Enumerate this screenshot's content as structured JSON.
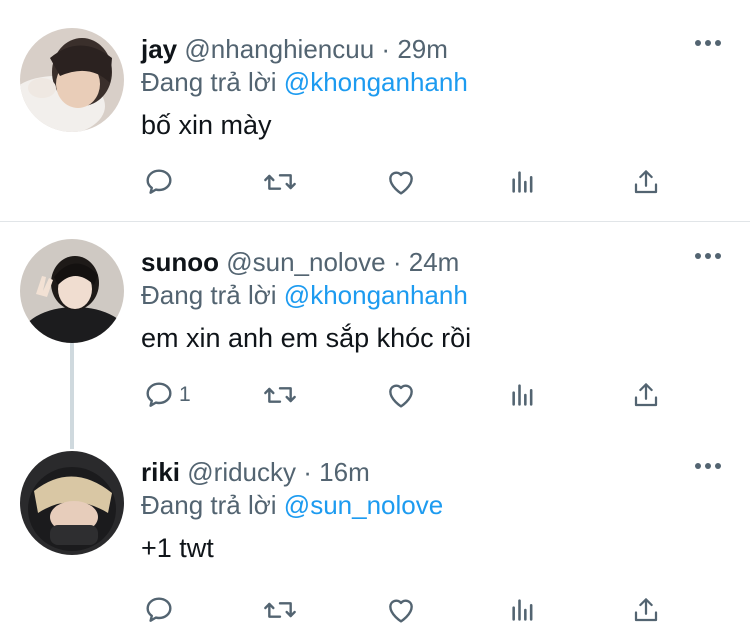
{
  "tweets": [
    {
      "name": "jay",
      "handle": "@nhanghiencuu",
      "sep": "·",
      "time": "29m",
      "replying_prefix": "Đang trả lời",
      "replying_to": "@khonganhanh",
      "text": "bố xin mày",
      "reply_count": ""
    },
    {
      "name": "sunoo",
      "handle": "@sun_nolove",
      "sep": "·",
      "time": "24m",
      "replying_prefix": "Đang trả lời",
      "replying_to": "@khonganhanh",
      "text": "em xin anh em sắp khóc rồi",
      "reply_count": "1"
    },
    {
      "name": "riki",
      "handle": "@riducky",
      "sep": "·",
      "time": "16m",
      "replying_prefix": "Đang trả lời",
      "replying_to": "@sun_nolove",
      "text": "+1 twt",
      "reply_count": ""
    }
  ],
  "icons": {
    "reply": "reply-icon",
    "retweet": "retweet-icon",
    "like": "heart-icon",
    "views": "views-icon",
    "share": "share-icon",
    "more": "more-icon"
  },
  "colors": {
    "mention": "#1d9bf0",
    "muted": "#536471",
    "text": "#0f1419",
    "thread_line": "#cfd9de"
  }
}
